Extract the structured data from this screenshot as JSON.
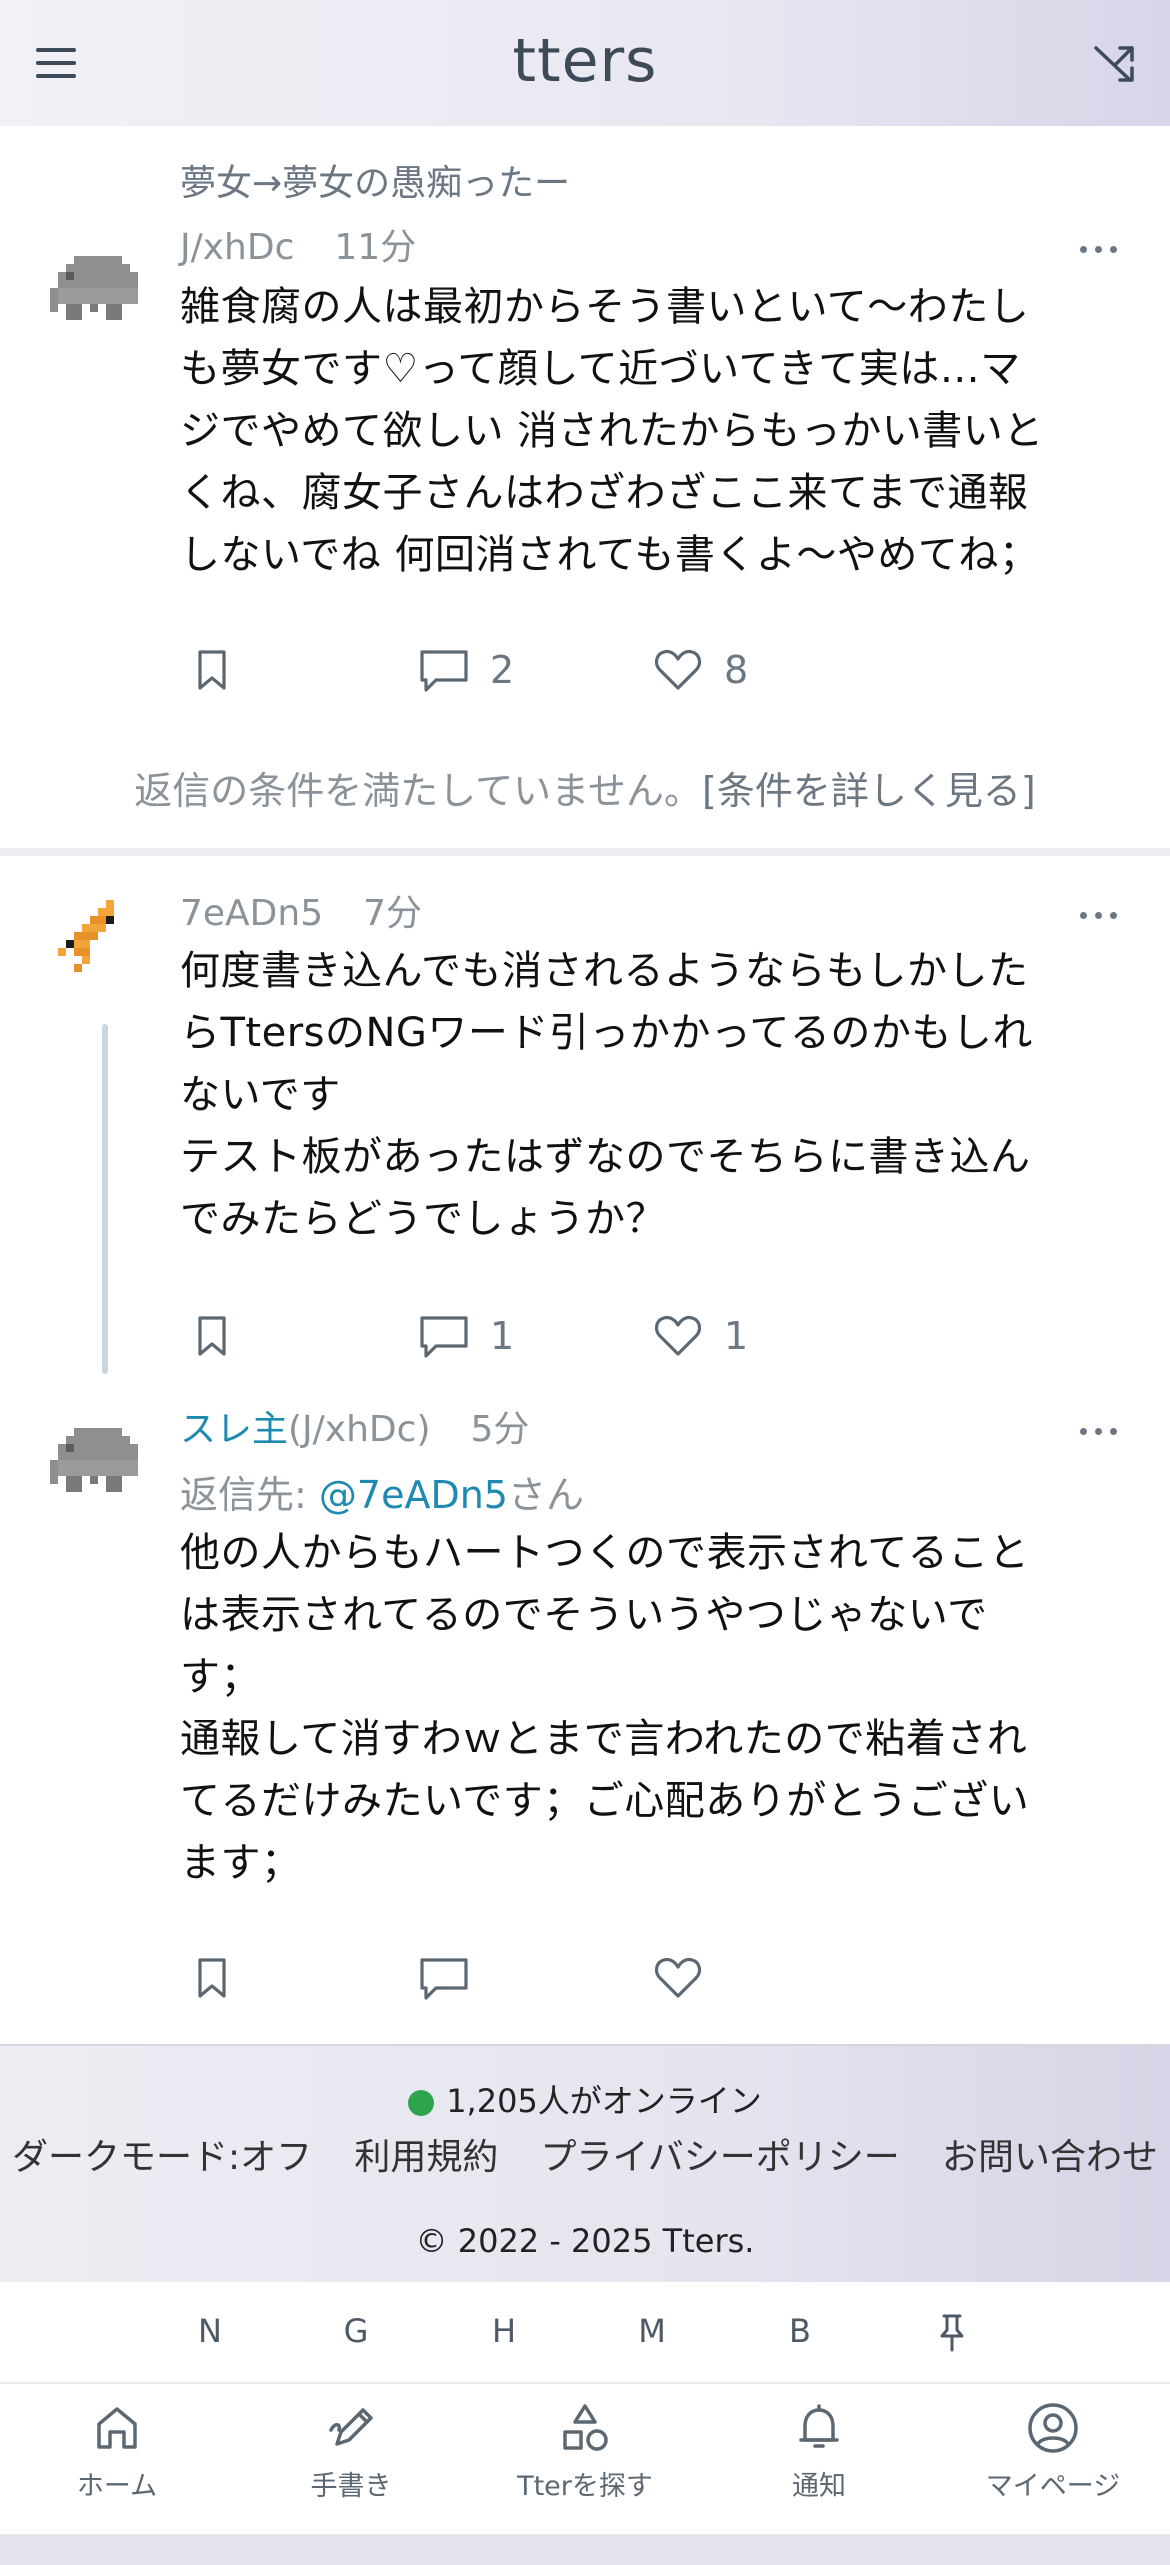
{
  "header": {
    "title": "tters",
    "menu_icon": "hamburger-menu-icon",
    "shuffle_icon": "shuffle-icon"
  },
  "posts": [
    {
      "board": "夢女→夢女の愚痴ったー",
      "uid": "J/xhDc",
      "time": "11分",
      "avatar": "gray-elephant-pixel-avatar",
      "text": "雑食腐の人は最初からそう書いといて〜わたし\nも夢女です♡って顔して近づいてきて実は…マ\nジでやめて欲しい 消されたからもっかい書いと\nくね、腐女子さんはわざわざここ来てまで通報\nしないでね 何回消されても書くよ〜やめてね；",
      "replies": "2",
      "likes": "8"
    },
    {
      "uid": "7eADn5",
      "time": "7分",
      "avatar": "orange-bird-pixel-avatar",
      "text": "何度書き込んでも消されるようならもしかした\nらTtersのNGワード引っかかってるのかもしれ\nないです\nテスト板があったはずなのでそちらに書き込ん\nでみたらどうでしょうか？",
      "replies": "1",
      "likes": "1"
    },
    {
      "op_label": "スレ主",
      "uid_paren": "(J/xhDc)",
      "time": "5分",
      "avatar": "gray-elephant-pixel-avatar",
      "reply_to_prefix": "返信先: ",
      "reply_to_mention": "@7eADn5",
      "reply_to_suffix": "さん",
      "text": "他の人からもハートつくので表示されてること\nは表示されてるのでそういうやつじゃないで\nす；\n通報して消すわｗとまで言われたので粘着され\nてるだけみたいです；ご心配ありがとうござい\nます；"
    }
  ],
  "reply_note": {
    "text": "返信の条件を満たしていません。",
    "link": "[条件を詳しく見る]"
  },
  "footer": {
    "online": "1,205人がオンライン",
    "links": [
      "ダークモード:オフ",
      "利用規約",
      "プライバシーポリシー",
      "お問い合わせ"
    ],
    "copyright": "© 2022 - 2025 Tters.",
    "online_color": "#2ea44f"
  },
  "letters": [
    "N",
    "G",
    "H",
    "M",
    "B"
  ],
  "pin_icon": "pin-icon",
  "nav": [
    {
      "label": "ホーム",
      "icon": "home-icon"
    },
    {
      "label": "手書き",
      "icon": "pencil-icon"
    },
    {
      "label": "Tterを探す",
      "icon": "shapes-icon"
    },
    {
      "label": "通知",
      "icon": "bell-icon"
    },
    {
      "label": "マイページ",
      "icon": "user-circle-icon"
    }
  ],
  "colors": {
    "accent": "#1f8ab0",
    "muted": "#8a929a",
    "icon": "#5b6873"
  }
}
